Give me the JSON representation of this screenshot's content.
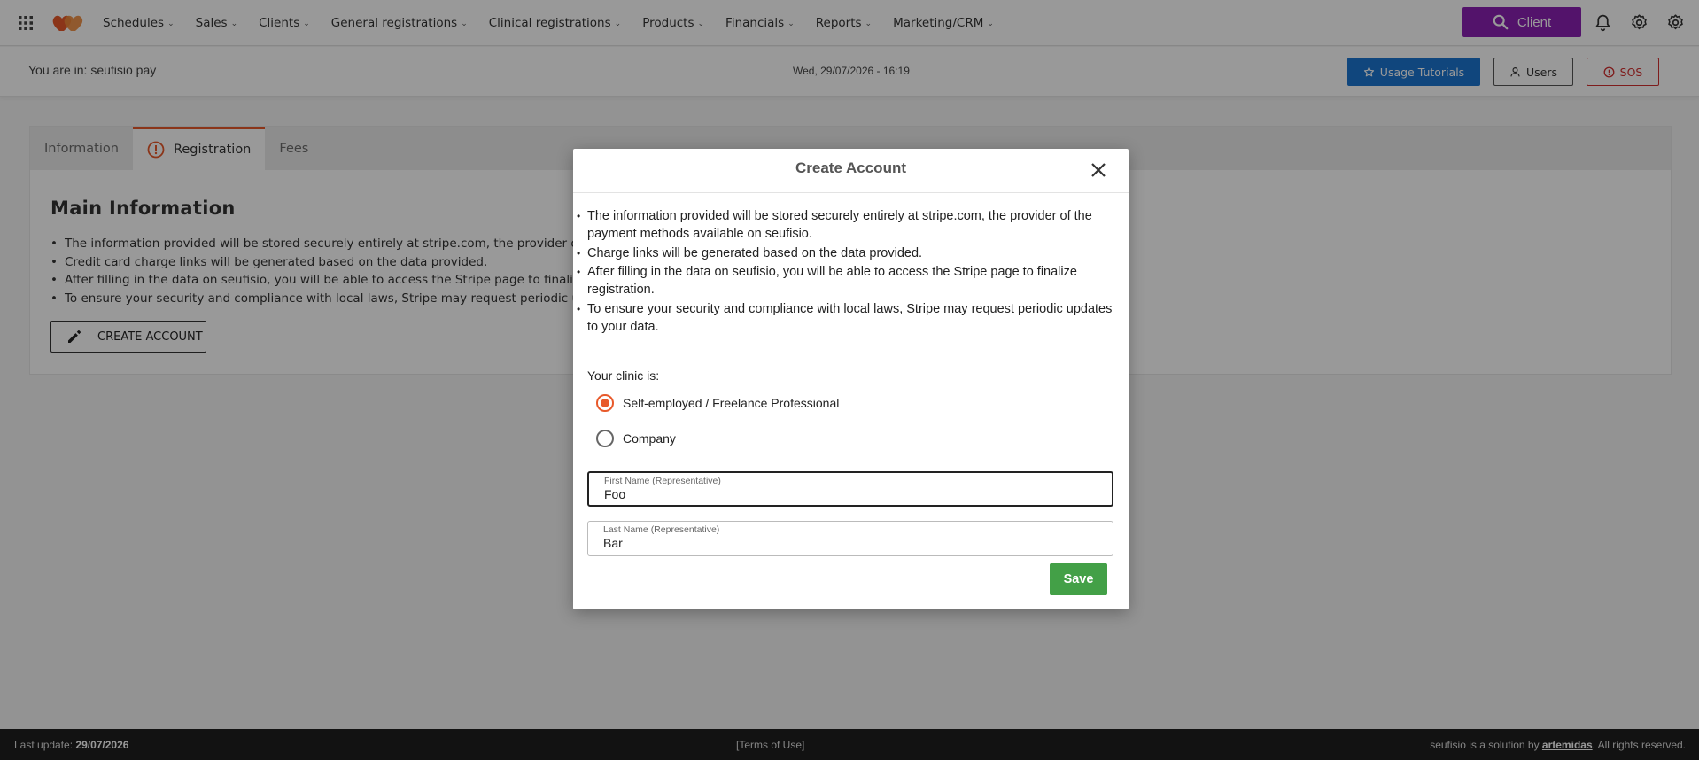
{
  "nav": {
    "menu": [
      {
        "label": "Schedules"
      },
      {
        "label": "Sales"
      },
      {
        "label": "Clients"
      },
      {
        "label": "General registrations"
      },
      {
        "label": "Clinical registrations"
      },
      {
        "label": "Products"
      },
      {
        "label": "Financials"
      },
      {
        "label": "Reports"
      },
      {
        "label": "Marketing/CRM"
      }
    ],
    "client_button": "Client"
  },
  "header": {
    "breadcrumb": "You are in: seufisio pay",
    "datetime": "Wed, 29/07/2026 - 16:19",
    "tutorials": "Usage Tutorials",
    "users": "Users",
    "sos": "SOS"
  },
  "tabs": [
    {
      "label": "Information"
    },
    {
      "label": "Registration"
    },
    {
      "label": "Fees"
    }
  ],
  "main": {
    "title": "Main Information",
    "items": [
      "The information provided will be stored securely entirely at stripe.com, the provider of the pa",
      "Credit card charge links will be generated based on the data provided.",
      "After filling in the data on seufisio, you will be able to access the Stripe page to finalize regist",
      "To ensure your security and compliance with local laws, Stripe may request periodic updates"
    ],
    "create_button": "CREATE ACCOUNT"
  },
  "modal": {
    "title": "Create Account",
    "items": [
      "The information provided will be stored securely entirely at stripe.com, the provider of the payment methods available on seufisio.",
      "Charge links will be generated based on the data provided.",
      "After filling in the data on seufisio, you will be able to access the Stripe page to finalize registration.",
      "To ensure your security and compliance with local laws, Stripe may request periodic updates to your data."
    ],
    "clinic_label": "Your clinic is:",
    "options": [
      {
        "label": "Self-employed / Freelance Professional",
        "selected": true
      },
      {
        "label": "Company",
        "selected": false
      }
    ],
    "first_name": {
      "label": "First Name (Representative)",
      "value": "Foo"
    },
    "last_name": {
      "label": "Last Name (Representative)",
      "value": "Bar"
    },
    "save": "Save"
  },
  "footer": {
    "last_update_label": "Last update: ",
    "last_update_value": "29/07/2026",
    "terms": "[Terms of Use]",
    "credit_prefix": "seufisio is a solution by ",
    "credit_link": "artemidas",
    "credit_suffix": ". All rights reserved."
  },
  "colors": {
    "accent_orange": "#e8592a",
    "client_purple": "#8a21b3",
    "tutorials_blue": "#1b75d0",
    "sos_red": "#d32f2f",
    "save_green": "#43a047"
  }
}
